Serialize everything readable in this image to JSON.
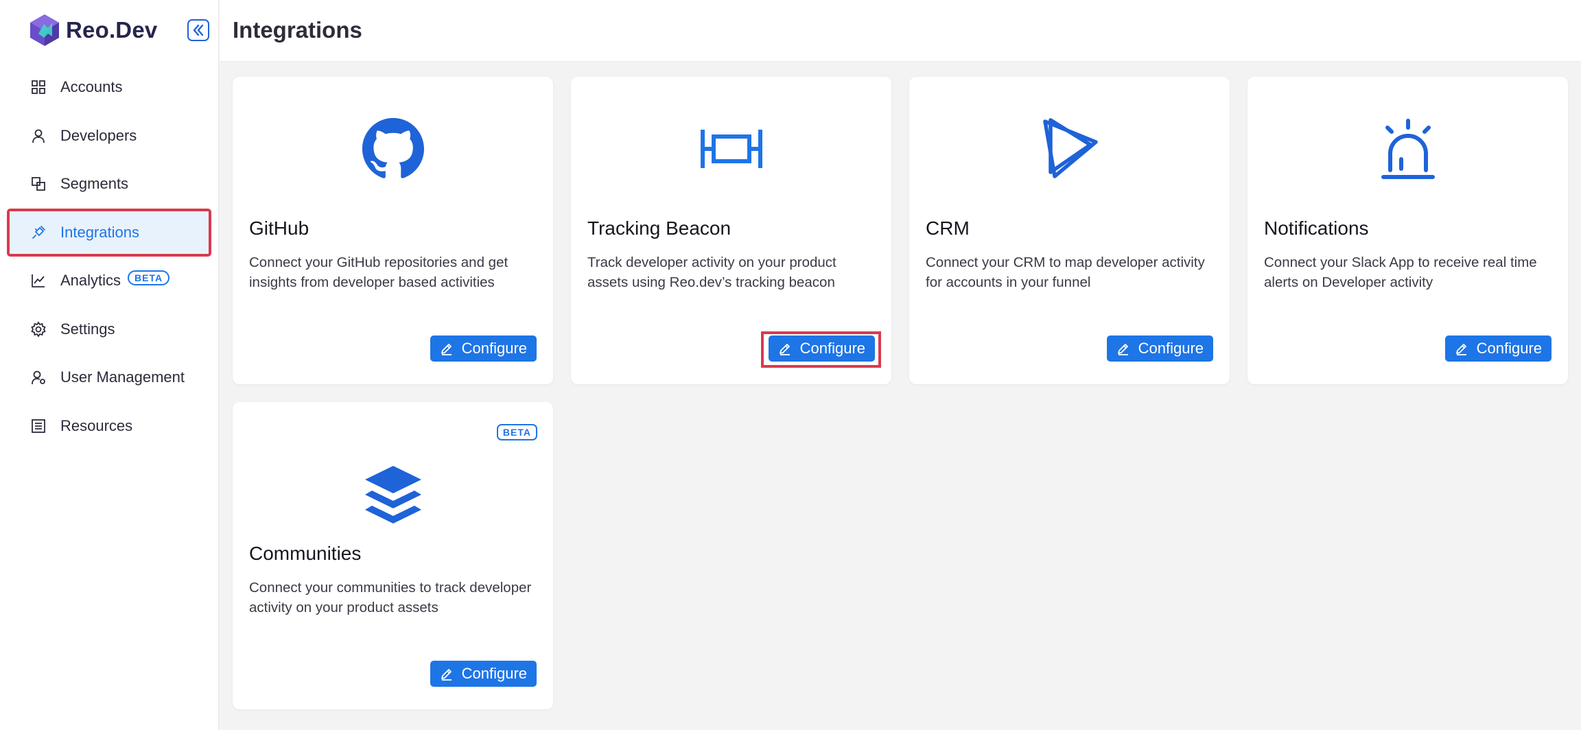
{
  "brand": {
    "name": "Reo.Dev",
    "logo_icon": "reo-logo-icon",
    "collapse_icon": "collapse-sidebar-icon"
  },
  "colors": {
    "accent": "#1e75e6",
    "highlight": "#d93a4f",
    "active_bg": "#e8f2fd"
  },
  "sidebar": {
    "items": [
      {
        "label": "Accounts",
        "icon": "grid-icon",
        "active": false
      },
      {
        "label": "Developers",
        "icon": "user-icon",
        "active": false
      },
      {
        "label": "Segments",
        "icon": "segments-icon",
        "active": false
      },
      {
        "label": "Integrations",
        "icon": "plug-icon",
        "active": true
      },
      {
        "label": "Analytics",
        "icon": "chart-icon",
        "badge": "BETA",
        "active": false
      },
      {
        "label": "Settings",
        "icon": "gear-icon",
        "active": false
      },
      {
        "label": "User Management",
        "icon": "user-manage-icon",
        "active": false
      },
      {
        "label": "Resources",
        "icon": "list-icon",
        "active": false
      }
    ]
  },
  "header": {
    "title": "Integrations"
  },
  "cards": [
    {
      "title": "GitHub",
      "description": "Connect your GitHub repositories and get insights from developer based activities",
      "button": "Configure",
      "icon": "github-icon"
    },
    {
      "title": "Tracking Beacon",
      "description": "Track developer activity on your product assets using Reo.dev’s tracking beacon",
      "button": "Configure",
      "icon": "beacon-icon"
    },
    {
      "title": "CRM",
      "description": "Connect your CRM to map developer activity for accounts in your funnel",
      "button": "Configure",
      "icon": "crm-icon"
    },
    {
      "title": "Notifications",
      "description": "Connect your Slack App to receive real time alerts on Developer activity",
      "button": "Configure",
      "icon": "alarm-icon"
    },
    {
      "title": "Communities",
      "description": "Connect your communities to track developer activity on your product assets",
      "button": "Configure",
      "icon": "layers-icon",
      "badge": "BETA"
    }
  ]
}
